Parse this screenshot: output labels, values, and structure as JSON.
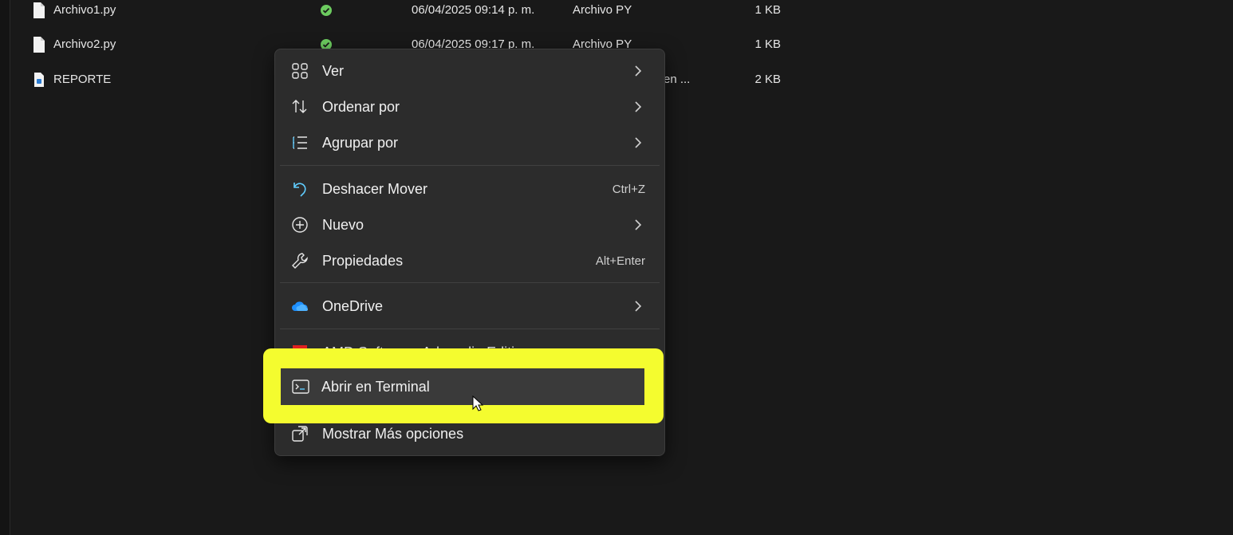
{
  "files": [
    {
      "name": "Archivo1.py",
      "status": "synced",
      "date": "06/04/2025 09:14 p. m.",
      "type": "Archivo PY",
      "size": "1 KB"
    },
    {
      "name": "Archivo2.py",
      "status": "synced",
      "date": "06/04/2025 09:17 p. m.",
      "type": "Archivo PY",
      "size": "1 KB"
    },
    {
      "name": "REPORTE",
      "status": "",
      "date": "",
      "type": "en ...",
      "size": "2 KB"
    }
  ],
  "context_menu": {
    "items": [
      {
        "label": "Ver",
        "icon": "grid-icon",
        "submenu": true
      },
      {
        "label": "Ordenar por",
        "icon": "sort-icon",
        "submenu": true
      },
      {
        "label": "Agrupar por",
        "icon": "list-icon",
        "submenu": true
      },
      {
        "label": "Deshacer Mover",
        "icon": "undo-icon",
        "shortcut": "Ctrl+Z"
      },
      {
        "label": "Nuevo",
        "icon": "plus-circle-icon",
        "submenu": true
      },
      {
        "label": "Propiedades",
        "icon": "wrench-icon",
        "shortcut": "Alt+Enter"
      },
      {
        "label": "OneDrive",
        "icon": "onedrive-cloud-icon",
        "submenu": true
      },
      {
        "label": "AMD Software: Adrenalin Edition",
        "icon": "amd-icon"
      },
      {
        "label": "Abrir en Terminal",
        "icon": "terminal-icon",
        "highlighted": true
      },
      {
        "label": "Mostrar Más opciones",
        "icon": "more-options-icon"
      }
    ]
  },
  "colors": {
    "background": "#191919",
    "menu_bg": "#2c2c2c",
    "highlight": "#f4fc2f",
    "accent": "#60cdff",
    "sync_green": "#6ccb5f",
    "amd_red": "#e0201f"
  }
}
